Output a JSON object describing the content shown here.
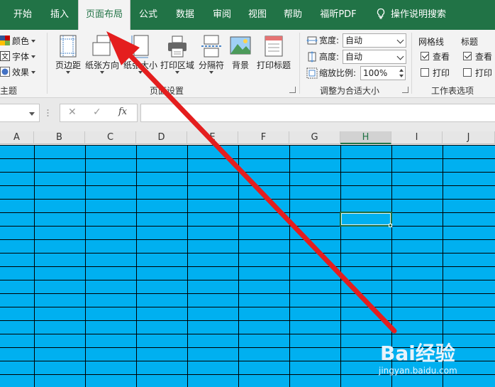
{
  "ribbon_tabs": [
    {
      "label": "开始"
    },
    {
      "label": "插入"
    },
    {
      "label": "页面布局",
      "active": true
    },
    {
      "label": "公式"
    },
    {
      "label": "数据"
    },
    {
      "label": "审阅"
    },
    {
      "label": "视图"
    },
    {
      "label": "帮助"
    },
    {
      "label": "福昕PDF"
    },
    {
      "label": "操作说明搜索",
      "icon": "lightbulb-icon"
    }
  ],
  "themes_group": {
    "colors_label": "颜色",
    "fonts_label": "字体",
    "effects_label": "效果",
    "group_label": "主题"
  },
  "page_setup_group": {
    "buttons": [
      {
        "label": "页边距",
        "icon": "margins-icon"
      },
      {
        "label": "纸张方向",
        "icon": "orientation-icon"
      },
      {
        "label": "纸张大小",
        "icon": "paper-size-icon"
      },
      {
        "label": "打印区域",
        "icon": "print-area-icon"
      },
      {
        "label": "分隔符",
        "icon": "breaks-icon"
      },
      {
        "label": "背景",
        "icon": "background-icon"
      },
      {
        "label": "打印标题",
        "icon": "print-titles-icon"
      }
    ],
    "group_label": "页面设置"
  },
  "scale_group": {
    "width_label": "宽度:",
    "width_value": "自动",
    "height_label": "高度:",
    "height_value": "自动",
    "scale_label": "缩放比例:",
    "scale_value": "100%",
    "group_label": "调整为合适大小"
  },
  "sheet_options_group": {
    "gridlines_title": "网格线",
    "headings_title": "标题",
    "view_label": "查看",
    "print_label": "打印",
    "gridlines_view": true,
    "gridlines_print": false,
    "headings_view": true,
    "headings_print": false,
    "group_label": "工作表选项"
  },
  "formula_bar": {
    "cancel_glyph": "✕",
    "enter_glyph": "✓",
    "fx_label": "fx",
    "formula_value": ""
  },
  "columns": [
    "A",
    "B",
    "C",
    "D",
    "E",
    "F",
    "G",
    "H",
    "I",
    "J"
  ],
  "selected_column": "H",
  "colors": {
    "ribbon_green": "#217346",
    "sheet_fill": "#00b0f0",
    "arrow_red": "#e41e1e"
  },
  "watermark": {
    "logo": "Bai经验",
    "url": "jingyan.baidu.com"
  }
}
